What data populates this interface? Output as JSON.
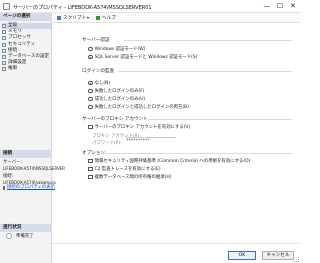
{
  "window": {
    "title": "サーバーのプロパティ - LIFEBOOK-A574\\MSSQLSERVER01",
    "minimize": "—",
    "maximize": "☐",
    "close": "✕"
  },
  "left": {
    "select_page_header": "ページの選択",
    "pages": [
      {
        "label": "全般",
        "icon": "page-icon"
      },
      {
        "label": "メモリ",
        "icon": "page-icon"
      },
      {
        "label": "プロセッサ",
        "icon": "page-icon"
      },
      {
        "label": "セキュリティ",
        "icon": "page-icon"
      },
      {
        "label": "接続",
        "icon": "page-icon"
      },
      {
        "label": "データベースの設定",
        "icon": "page-icon"
      },
      {
        "label": "詳細設定",
        "icon": "page-icon"
      },
      {
        "label": "権限",
        "icon": "page-icon"
      }
    ],
    "connection_header": "接続",
    "server_label": "サーバー:",
    "server_value": "LIFEBOOK-A574\\MSSQLSERVER",
    "connection_label": "接続:",
    "connection_value": "LIFEBOOK-A574\\nakamura",
    "view_props_link": "接続のプロパティの表示",
    "progress_header": "進行状況",
    "progress_status": "準備完了"
  },
  "toolbar": {
    "script_label": "スクリプト",
    "help_label": "ヘルプ"
  },
  "auth": {
    "group_title": "サーバー認証",
    "windows_only": "Windows 認証モード(W)",
    "mixed": "SQL Server 認証モードと Windows 認証モード(S)",
    "selected": "mixed"
  },
  "login_audit": {
    "group_title": "ログインの監査",
    "options": [
      "なし(N)",
      "失敗したログインのみ(F)",
      "成功したログインのみ(U)",
      "失敗したログインと成功したログインの両方(B)"
    ],
    "selected_index": 0
  },
  "proxy": {
    "group_title": "サーバーのプロキシ アカウント",
    "enable_label": "サーバーのプロキシ アカウントを有効にする(V)",
    "enabled": false,
    "account_label": "プロキシ アカウント(R):",
    "account_value": "",
    "password_label": "パスワード(P):",
    "password_value": "**********"
  },
  "options": {
    "group_title": "オプション",
    "items": [
      {
        "label": "情報セキュリティ国際評価基準 (Common Criteria) への準拠を有効にする(O)",
        "checked": false
      },
      {
        "label": "C2 監査トレースを有効にする(E)",
        "checked": false
      },
      {
        "label": "複数データベース間の所有権の継承(H)",
        "checked": false
      }
    ]
  },
  "footer": {
    "ok_label": "OK",
    "cancel_label": "キャンセル"
  },
  "colors": {
    "section_header_bg": "#d6dbe9",
    "link": "#1a55c0",
    "primary_border": "#3c6fc2"
  }
}
